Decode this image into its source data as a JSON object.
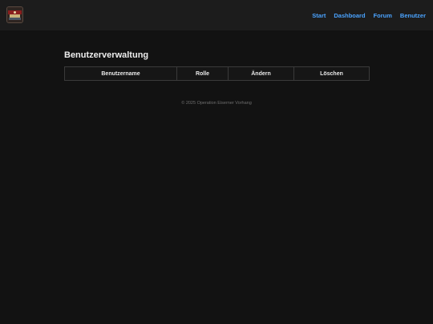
{
  "header": {
    "logo_icon": "game-logo-icon",
    "nav": [
      {
        "label": "Start"
      },
      {
        "label": "Dashboard"
      },
      {
        "label": "Forum"
      },
      {
        "label": "Benutzer"
      }
    ],
    "accent_color": "#4aa3ff"
  },
  "main": {
    "title": "Benutzerverwaltung",
    "table": {
      "columns": [
        "Benutzername",
        "Rolle",
        "Ändern",
        "Löschen"
      ],
      "rows": []
    }
  },
  "footer": {
    "text": "© 2025 Operation Eiserner Vorhang"
  }
}
